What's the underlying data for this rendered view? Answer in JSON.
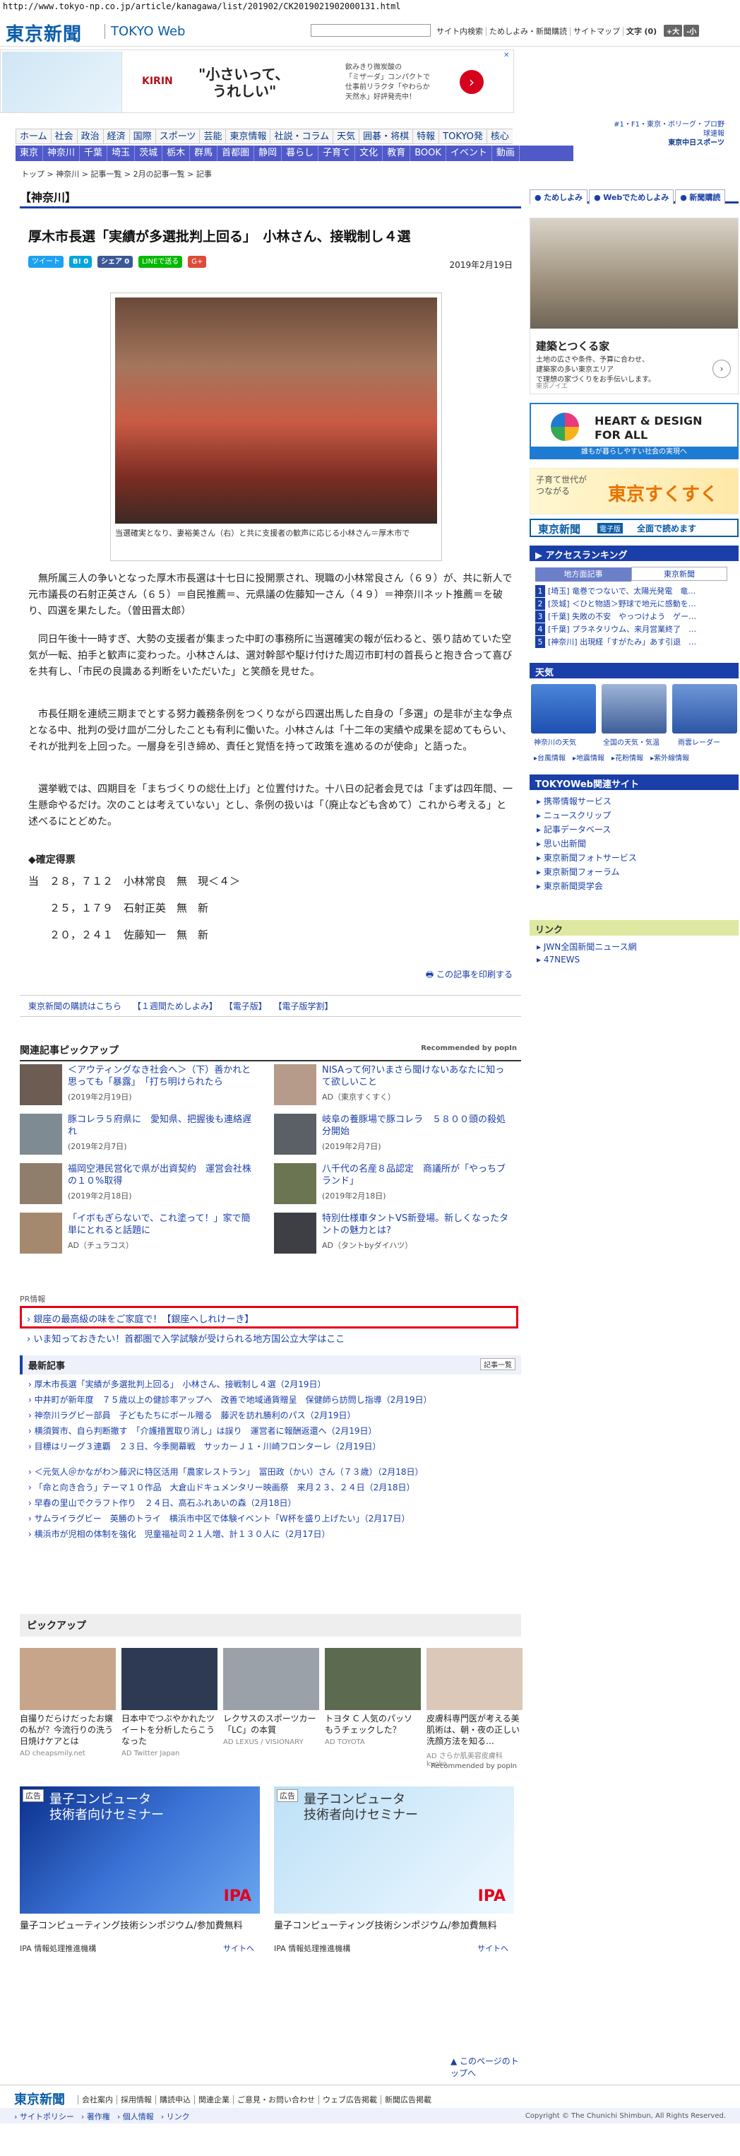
{
  "url": "http://www.tokyo-np.co.jp/article/kanagawa/list/201902/CK2019021902000131.html",
  "header": {
    "logo": "東京新聞",
    "sub": "TOKYO Web",
    "search_btn": "サイト内検索",
    "links": [
      "ためしよみ・新聞購読",
      "サイトマップ"
    ],
    "font_label": "文字",
    "font_value": "(0)",
    "font_plus": "+大",
    "font_minus": "-小"
  },
  "ad": {
    "brand": "KIRIN",
    "copy1": "\"小さいって、",
    "copy2": "うれしい\"",
    "small": [
      "飲みきり微炭酸の",
      "「ミザーダ」コンパクトで",
      "仕事前リラクタ「やわらか",
      "天然水」好評発売中！"
    ],
    "arrow": "›",
    "close": "✕"
  },
  "chunichi": [
    "#1・F1・東京・ボリーグ・プロ野球速報",
    "東京中日スポーツ"
  ],
  "nav1": [
    "ホーム",
    "社会",
    "政治",
    "経済",
    "国際",
    "スポーツ",
    "芸能",
    "東京情報",
    "社説・コラム",
    "天気",
    "囲碁・将棋",
    "特報",
    "TOKYO発",
    "核心"
  ],
  "nav2": [
    "東京",
    "神奈川",
    "千葉",
    "埼玉",
    "茨城",
    "栃木",
    "群馬",
    "首都圏",
    "静岡",
    "暮らし",
    "子育て",
    "文化",
    "教育",
    "BOOK",
    "イベント",
    "動画"
  ],
  "breadcrumb": "トップ > 神奈川 > 記事一覧 > 2月の記事一覧 > 記事",
  "section": "【神奈川】",
  "article": {
    "title": "厚木市長選「実績が多選批判上回る」　小林さん、接戦制し４選",
    "date": "2019年2月19日",
    "social": {
      "tweet": "ツイート",
      "b": "B!",
      "b_count": "0",
      "share": "シェア",
      "share_count": "0",
      "line": "LINEで送る",
      "gplus": "G+"
    },
    "caption": "当選確実となり、妻裕美さん（右）と共に支援者の歓声に応じる小林さん＝厚木市で",
    "paras": [
      "無所属三人の争いとなった厚木市長選は十七日に投開票され、現職の小林常良さん（６９）が、共に新人で元市議長の石射正英さん（６５）＝自民推薦＝、元県議の佐藤知一さん（４９）＝神奈川ネット推薦＝を破り、四選を果たした。（曽田晋太郎）",
      "同日午後十一時すぎ、大勢の支援者が集まった中町の事務所に当選確実の報が伝わると、張り詰めていた空気が一転、拍手と歓声に変わった。小林さんは、選対幹部や駆け付けた周辺市町村の首長らと抱き合って喜びを共有し、「市民の良識ある判断をいただいた」と笑顔を見せた。",
      "市長任期を連続三期までとする努力義務条例をつくりながら四選出馬した自身の「多選」の是非が主な争点となる中、批判の受け皿が二分したことも有利に働いた。小林さんは「十二年の実績や成果を認めてもらい、それが批判を上回った。一層身を引き締め、責任と覚悟を持って政策を進めるのが使命」と語った。",
      "選挙戦では、四期目を「まちづくりの総仕上げ」と位置付けた。十八日の記者会見では「まずは四年間、一生懸命やるだけ。次のことは考えていない」とし、条例の扱いは「（廃止なども含めて）これから考える」と述べるにとどめた。"
    ],
    "results_label": "◆確定得票",
    "results": [
      "当　２８，７１２　小林常良　無　現＜４＞",
      "　　２５，１７９　石射正英　無　新",
      "　　２０，２４１　佐藤知一　無　新"
    ],
    "print": "この記事を印刷する"
  },
  "subs": [
    "東京新聞の購読はこちら",
    "【１週間ためしよみ】",
    "【電子版】",
    "【電子版学割】"
  ],
  "related": {
    "title": "関連記事ピックアップ",
    "popin": "Recommended by popIn",
    "items": [
      {
        "t": "＜アウティングなき社会へ＞（下）善かれと思っても「暴露」　「打ち明けられたら",
        "d": "(2019年2月19日)"
      },
      {
        "t": "NISAって何?いまさら聞けないあなたに知って欲しいこと",
        "d": "AD（東京すくすく）"
      },
      {
        "t": "豚コレラ５府県に　愛知県、把握後も連絡遅れ",
        "d": "(2019年2月7日)"
      },
      {
        "t": "岐阜の養豚場で豚コレラ　５８００頭の殺処分開始",
        "d": "(2019年2月7日)"
      },
      {
        "t": "福岡空港民営化で県が出資契約　運営会社株の１０%取得",
        "d": "(2019年2月18日)"
      },
      {
        "t": "八千代の名産８品認定　商議所が「やっちブランド」",
        "d": "(2019年2月18日)"
      },
      {
        "t": "「イボもぎらないで、これ塗って！」家で簡単にとれると話題に",
        "d": "AD（チュラコス）"
      },
      {
        "t": "特別仕様車タントVS新登場。新しくなったタントの魅力とは?",
        "d": "AD（タントbyダイハツ）"
      }
    ]
  },
  "pr": {
    "label": "PR情報",
    "items": [
      "銀座の最高級の味をご家庭で！【銀座へしれけーき】",
      "いま知っておきたい！首都圏で入学試験が受けられる地方国公立大学はここ"
    ]
  },
  "latest": {
    "title": "最新記事",
    "more": "記事一覧",
    "items": [
      "厚木市長選「実績が多選批判上回る」　小林さん、接戦制し４選（2月19日）",
      "中井町が新年度　７５歳以上の健診率アップへ　改善で地域通貨贈呈　保健師ら訪問し指導（2月19日）",
      "神奈川ラグビー部員　子どもたちにボール贈る　藤沢を訪れ勝利のパス（2月19日）",
      "横須賀市、自ら判断撤す　「介護措置取り消し」は誤り　運営者に報酬返還へ（2月19日）",
      "目標はリーグ３連覇　２３日、今季開幕戦　サッカーＪ１・川崎フロンターレ（2月19日）",
      "＜元気人＠かながわ＞藤沢に特区活用「農家レストラン」　冨田政（かい）さん（７３歳）（2月18日）",
      "「命と向き合う」テーマ１０作品　大倉山ドキュメンタリー映画祭　来月２３、２４日（2月18日）",
      "早春の里山でクラフト作り　２４日、高石ふれあいの森（2月18日）",
      "サムライラグビー　英勝のトライ　横浜市中区で体験イベント「W杯を盛り上げたい」（2月17日）",
      "横浜市が児相の体制を強化　児童福祉司２１人増、計１３０人に（2月17日）"
    ]
  },
  "pickup": {
    "title": "ピックアップ",
    "items": [
      {
        "t": "自撮りだらけだったお嬢の私が？今流行りの洗う日焼けケアとは",
        "a": "AD cheapsmily.net"
      },
      {
        "t": "日本中でつぶやかれたツイートを分析したらこうなった",
        "a": "AD Twitter Japan"
      },
      {
        "t": "レクサスのスポーツカー「LC」の本質",
        "a": "AD LEXUS / VISIONARY"
      },
      {
        "t": "トヨタ C 人気のパッソもうチェックした？",
        "a": "AD TOYOTA"
      },
      {
        "t": "皮膚科専門医が考える美肌術は、朝・夜の正しい洗顔方法を知る…",
        "a": "AD さらか肌美容皮膚科 kyoko"
      }
    ],
    "popin": "Recommended by popIn"
  },
  "bottom_ads": [
    {
      "label": "広告",
      "head": [
        "量子コンピュータ",
        "技術者向けセミナー"
      ],
      "title": "量子コンピューティング技術シンポジウム/参加費無料",
      "src": "IPA 情報処理推進機構",
      "go": "サイトへ",
      "ipa": "IPA"
    },
    {
      "label": "広告",
      "head": [
        "量子コンピュータ",
        "技術者向けセミナー"
      ],
      "title": "量子コンピューティング技術シンポジウム/参加費無料",
      "src": "IPA 情報処理推進機構",
      "go": "サイトへ",
      "ipa": "IPA"
    }
  ],
  "totop": "このページのトップへ",
  "footer": {
    "logo": "東京新聞",
    "links": [
      "会社案内",
      "採用情報",
      "購読申込",
      "関連企業",
      "ご意見・お問い合わせ",
      "ウェブ広告掲載",
      "新聞広告掲載"
    ],
    "links2": [
      "サイトポリシー",
      "著作権",
      "個人情報",
      "リンク"
    ],
    "copyright": "Copyright © The Chunichi Shimbun, All Rights Reserved."
  },
  "sidebar": {
    "tabs": [
      "ためしよみ",
      "Webでためしよみ",
      "新聞購読"
    ],
    "ad1": {
      "title": "建築とつくる家",
      "sub": [
        "土地の広さや条件、予算に合わせ、",
        "建築家の多い東京エリア",
        "で理想の家づくりをお手伝いします。"
      ],
      "src": "東京ノイエ",
      "arrow": "›"
    },
    "ad2": {
      "t1": "HEART & DESIGN",
      "t2": "FOR ALL",
      "bar": "誰もが暮らしやすい社会の実現へ"
    },
    "ad3": {
      "a1": "子育て世代が",
      "a2": "つながる",
      "b": "東京すくすく"
    },
    "ad4": {
      "a": "東京新聞",
      "b": "電子版",
      "c": "全面で読めます"
    },
    "ranking": {
      "title": "アクセスランキング",
      "tabs": [
        "地方面記事",
        "東京新聞"
      ],
      "items": [
        "[埼玉] 竜巻でつないで、太陽光発電　竜…",
        "[茨城] ＜ひと物語＞野球で地元に感動を…",
        "[千葉] 失敗の不安　やっつけよう　ゲー…",
        "[千葉] プラネタリウム、来月営業終了　…",
        "[神奈川] 出現経「すがたみ」あす引退　…"
      ]
    },
    "weather": {
      "title": "天気",
      "items": [
        "神奈川の天気",
        "全国の天気・気温",
        "雨雲レーダー"
      ],
      "links": [
        "台風情報",
        "地震情報",
        "花粉情報",
        "紫外線情報"
      ]
    },
    "services": {
      "title": "TOKYOWeb関連サイト",
      "items": [
        "携帯情報サービス",
        "ニュースクリップ",
        "記事データベース",
        "思い出新聞",
        "東京新聞フォトサービス",
        "東京新聞フォーラム",
        "東京新聞奨学会"
      ]
    },
    "links": {
      "title": "リンク",
      "items": [
        "JWN全国新聞ニュース網",
        "47NEWS"
      ]
    }
  }
}
